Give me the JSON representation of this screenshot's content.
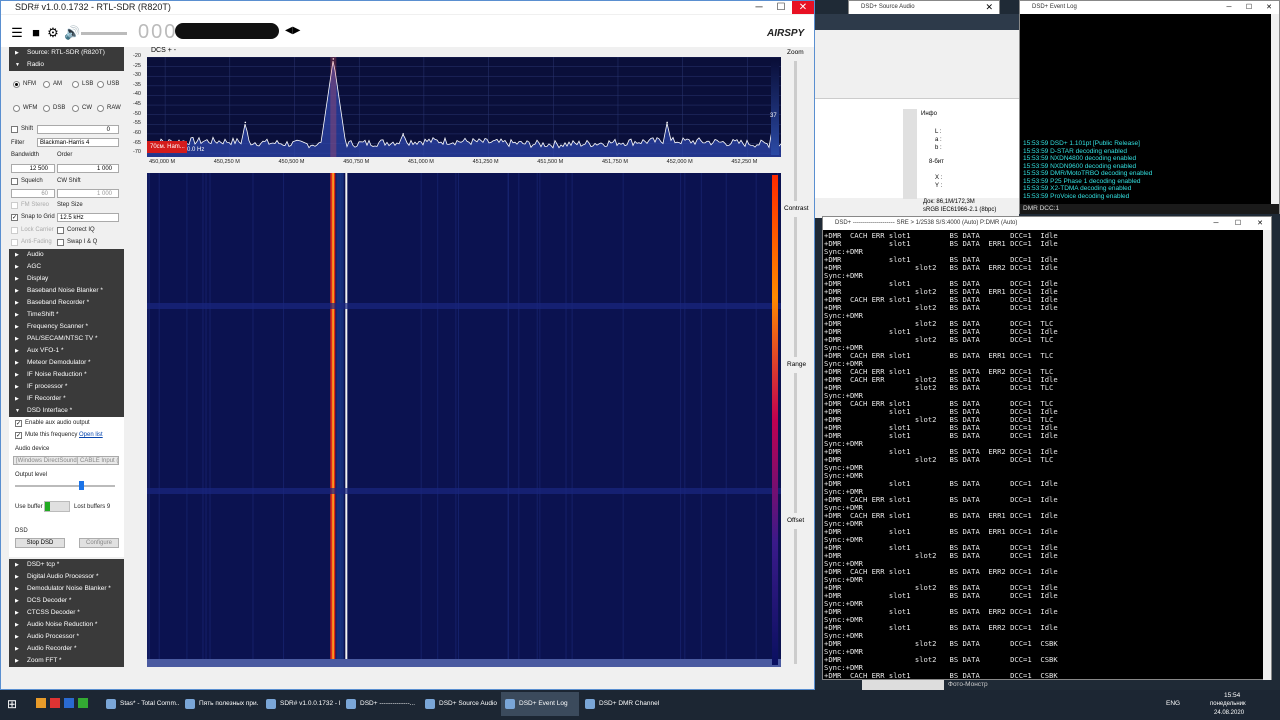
{
  "sdr": {
    "title": "SDR# v1.0.0.1732 - RTL-SDR (R820T)",
    "freq_display": "000",
    "brand": "AIRSPY",
    "source_label": "Source: RTL-SDR (R820T)",
    "radio_label": "Radio",
    "modes": [
      "NFM",
      "AM",
      "LSB",
      "USB",
      "WFM",
      "DSB",
      "CW",
      "RAW"
    ],
    "selected_mode": "NFM",
    "shift_label": "Shift",
    "shift_value": "0",
    "filter_label": "Filter",
    "filter_value": "Blackman-Harris 4",
    "bandwidth_label": "Bandwidth",
    "bandwidth_value": "12 500",
    "order_label": "Order",
    "order_value": "1 000",
    "squelch_label": "Squelch",
    "squelch_value": "60",
    "cwshift_label": "CW Shift",
    "cwshift_value": "1 000",
    "fmstereo_label": "FM Stereo",
    "stepsize_label": "Step Size",
    "snap_label": "Snap to Grid",
    "snap_value": "12.5 kHz",
    "lockcarrier_label": "Lock Carrier",
    "correctiq_label": "Correct IQ",
    "antifading_label": "Anti-Fading",
    "swapiq_label": "Swap I & Q",
    "sections_a": [
      "Audio",
      "AGC",
      "Display",
      "Baseband Noise Blanker *",
      "Baseband Recorder *",
      "TimeShift *",
      "Frequency Scanner *",
      "PAL/SECAM/NTSC TV *",
      "Aux VFO-1 *",
      "Meteor Demodulator *",
      "IF Noise Reduction *",
      "IF processor *",
      "IF Recorder *"
    ],
    "dsd_section": "DSD Interface *",
    "enable_aux": "Enable aux audio output",
    "mute_freq": "Mute this frequency",
    "open_list": "Open list",
    "audio_device_label": "Audio device",
    "audio_device_value": "[Windows DirectSound] CABLE Input (",
    "output_level_label": "Output level",
    "use_buffer_label": "Use buffer",
    "lost_buffers": "Lost buffers 9",
    "dsd_label": "DSD",
    "stop_dsd": "Stop DSD",
    "configure": "Configure",
    "sections_b": [
      "DSD+ tcp *",
      "Digital Audio Processor *",
      "Demodulator Noise Blanker *",
      "DCS Decoder *",
      "CTCSS Decoder *",
      "Audio Noise Reduction *",
      "Audio Processor *",
      "Audio Recorder *",
      "Zoom FFT *"
    ],
    "spectrum_title": "DCS + -",
    "marker_label": "70см. Ham...",
    "marker_offset": "0.0 Hz",
    "zoom_label": "Zoom",
    "contrast_label": "Contrast",
    "range_label": "Range",
    "offset_label": "Offset",
    "colorbar_value": "37"
  },
  "chart_data": {
    "type": "line",
    "title": "",
    "xlabel": "",
    "ylabel": "",
    "x_ticks": [
      "450,000 M",
      "450,250 M",
      "450,500 M",
      "450,750 M",
      "451,000 M",
      "451,250 M",
      "451,500 M",
      "451,750 M",
      "452,000 M",
      "452,250 M"
    ],
    "y_ticks": [
      "-20",
      "-25",
      "-30",
      "-35",
      "-40",
      "-45",
      "-50",
      "-55",
      "-60",
      "-65",
      "-70"
    ],
    "ylim": [
      -72,
      -20
    ],
    "xlim": [
      449.93,
      452.38
    ],
    "peaks": [
      {
        "x": 450.65,
        "y": -21
      },
      {
        "x": 450.31,
        "y": -54
      },
      {
        "x": 451.94,
        "y": -54
      },
      {
        "x": 450.92,
        "y": -60
      },
      {
        "x": 452.35,
        "y": -56
      }
    ],
    "noise_floor": -65
  },
  "source_audio": {
    "title": "DSD+ Source Audio"
  },
  "image_panel": {
    "info": "Инфо",
    "l": "L :",
    "a": "a :",
    "b": "b :",
    "bits": "8-бит",
    "x": "X :",
    "y": "Y :",
    "doc": "Док: 86,1M/172,3M",
    "profile": "sRGB IEC61966-2.1 (8bpc)"
  },
  "event_log": {
    "title": "DSD+ Event Log",
    "lines": [
      "15:53:59  DSD+ 1.101pt  [Public Release]",
      "15:53:59  D-STAR decoding enabled",
      "15:53:59  NXDN4800 decoding enabled",
      "15:53:59  NXDN9600 decoding enabled",
      "15:53:59  DMR/MotoTRBO decoding enabled",
      "15:53:59  P25 Phase 1 decoding enabled",
      "15:53:59  X2-TDMA decoding enabled",
      "15:53:59  ProVoice decoding enabled"
    ],
    "status": "DMR  DCC:1"
  },
  "dmr_window": {
    "title": "DSD+ --------------------- SRE > 1/2538  S/S:4000 (Auto) P:DMR (Auto)",
    "text": "+DMR  CACH ERR slot1         BS DATA       DCC=1  Idle\n+DMR           slot1         BS DATA  ERR1 DCC=1  Idle\nSync:+DMR\n+DMR           slot1         BS DATA       DCC=1  Idle\n+DMR                 slot2   BS DATA  ERR2 DCC=1  Idle\nSync:+DMR\n+DMR           slot1         BS DATA       DCC=1  Idle\n+DMR                 slot2   BS DATA  ERR1 DCC=1  Idle\n+DMR  CACH ERR slot1         BS DATA       DCC=1  Idle\n+DMR                 slot2   BS DATA       DCC=1  Idle\nSync:+DMR\n+DMR                 slot2   BS DATA       DCC=1  TLC\n+DMR           slot1         BS DATA       DCC=1  Idle\n+DMR                 slot2   BS DATA       DCC=1  TLC\nSync:+DMR\n+DMR  CACH ERR slot1         BS DATA  ERR1 DCC=1  TLC\nSync:+DMR\n+DMR  CACH ERR slot1         BS DATA  ERR2 DCC=1  TLC\n+DMR  CACH ERR       slot2   BS DATA       DCC=1  Idle\n+DMR                 slot2   BS DATA       DCC=1  TLC\nSync:+DMR\n+DMR  CACH ERR slot1         BS DATA       DCC=1  TLC\n+DMR           slot1         BS DATA       DCC=1  Idle\n+DMR                 slot2   BS DATA       DCC=1  TLC\n+DMR           slot1         BS DATA       DCC=1  Idle\n+DMR           slot1         BS DATA       DCC=1  Idle\nSync:+DMR\n+DMR           slot1         BS DATA  ERR2 DCC=1  Idle\n+DMR                 slot2   BS DATA       DCC=1  TLC\nSync:+DMR\nSync:+DMR\n+DMR           slot1         BS DATA       DCC=1  Idle\nSync:+DMR\n+DMR  CACH ERR slot1         BS DATA       DCC=1  Idle\nSync:+DMR\n+DMR  CACH ERR slot1         BS DATA  ERR1 DCC=1  Idle\nSync:+DMR\n+DMR           slot1         BS DATA  ERR1 DCC=1  Idle\nSync:+DMR\n+DMR           slot1         BS DATA       DCC=1  Idle\n+DMR                 slot2   BS DATA       DCC=1  Idle\nSync:+DMR\n+DMR  CACH ERR slot1         BS DATA  ERR2 DCC=1  Idle\nSync:+DMR\n+DMR                 slot2   BS DATA       DCC=1  Idle\n+DMR           slot1         BS DATA       DCC=1  Idle\nSync:+DMR\n+DMR           slot1         BS DATA  ERR2 DCC=1  Idle\nSync:+DMR\n+DMR           slot1         BS DATA  ERR2 DCC=1  Idle\nSync:+DMR\n+DMR                 slot2   BS DATA       DCC=1  CSBK\nSync:+DMR\n+DMR                 slot2   BS DATA       DCC=1  CSBK\nSync:+DMR\n+DMR  CACH ERR slot1         BS DATA       DCC=1  CSBK"
  },
  "taskbar": {
    "tasks": [
      "Stas* - Total Comm...",
      "Пять полезных при...",
      "SDR# v1.0.0.1732 - R...",
      "DSD+ --------------...",
      "DSD+ Source Audio",
      "DSD+ Event Log",
      "DSD+ DMR Channel ..."
    ],
    "active_index": 5,
    "photo_label": "Фото-Монстр",
    "lang": "ENG",
    "time": "15:54",
    "day": "понедельник",
    "date": "24.08.2020"
  },
  "colors": {
    "spectrum_bg": "#0a0f3a",
    "waterfall_bg": "#0b1250",
    "event_text": "#33e0e0",
    "close_red": "#e81123"
  }
}
